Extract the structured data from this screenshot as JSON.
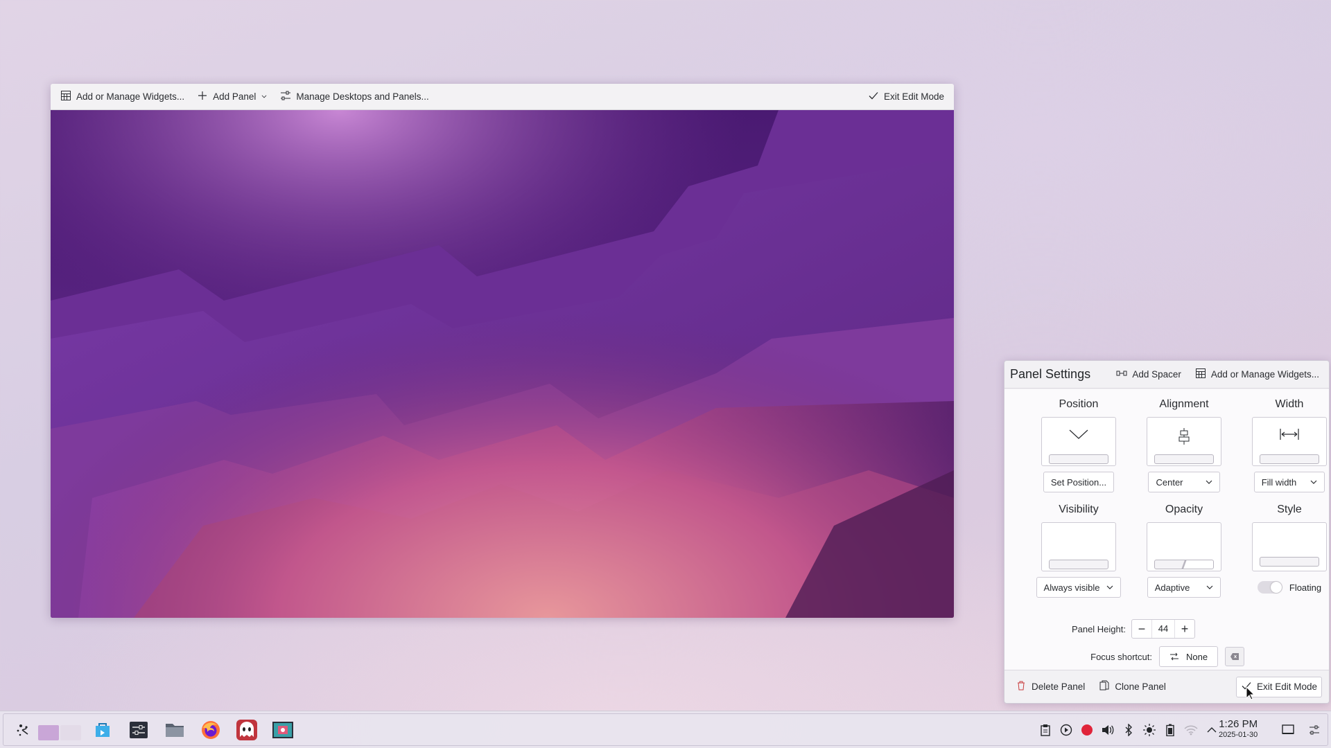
{
  "toolbar": {
    "add_widgets": "Add or Manage Widgets...",
    "add_panel": "Add Panel",
    "manage_desktops": "Manage Desktops and Panels...",
    "exit_edit": "Exit Edit Mode"
  },
  "panel_settings": {
    "title": "Panel Settings",
    "add_spacer": "Add Spacer",
    "add_widgets": "Add or Manage Widgets...",
    "position": {
      "title": "Position",
      "button": "Set Position..."
    },
    "alignment": {
      "title": "Alignment",
      "value": "Center"
    },
    "width": {
      "title": "Width",
      "value": "Fill width"
    },
    "visibility": {
      "title": "Visibility",
      "value": "Always visible"
    },
    "opacity": {
      "title": "Opacity",
      "value": "Adaptive"
    },
    "style": {
      "title": "Style",
      "toggle_label": "Floating"
    },
    "panel_height_label": "Panel Height:",
    "panel_height_value": "44",
    "focus_shortcut_label": "Focus shortcut:",
    "focus_shortcut_value": "None",
    "delete_panel": "Delete Panel",
    "clone_panel": "Clone Panel",
    "exit_edit": "Exit Edit Mode"
  },
  "taskbar": {
    "apps": [
      "application-launcher",
      "pager",
      "discover",
      "system-settings",
      "file-manager",
      "firefox",
      "ghost-app",
      "screenshot-app"
    ],
    "tray": [
      "clipboard-icon",
      "media-player-icon",
      "record-icon",
      "volume-icon",
      "bluetooth-icon",
      "brightness-icon",
      "battery-icon",
      "wifi-icon",
      "expand-tray-icon"
    ],
    "clock_time": "1:26 PM",
    "clock_date": "2025-01-30"
  },
  "colors": {
    "record": "#e0243a",
    "accent": "#3daee9"
  }
}
